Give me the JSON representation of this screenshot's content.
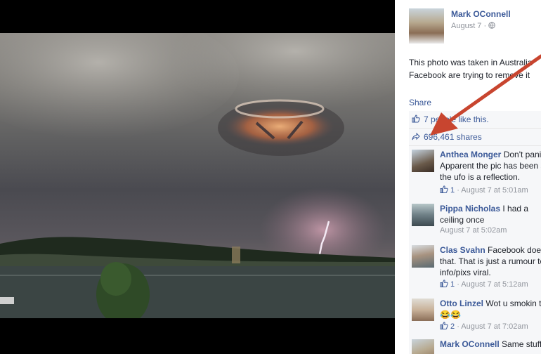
{
  "post": {
    "author": "Mark OConnell",
    "date": "August 7",
    "separator": "·",
    "privacy_icon": "globe-icon",
    "text": "This photo was taken in Australia Facebook are trying to remove it",
    "share_label": "Share",
    "likes": "7 people like this.",
    "shares": "696,461 shares"
  },
  "comments": [
    {
      "name": "Anthea Monger",
      "text": "Don't panic Apparent the pic has been so the ufo is a reflection.",
      "likes": "1",
      "time": "· August 7 at 5:01am"
    },
    {
      "name": "Pippa Nicholas",
      "text": "I had a ceiling once",
      "likes": "",
      "time": "August 7 at 5:02am"
    },
    {
      "name": "Clas Svahn",
      "text": "Facebook does that. That is just a rumour to info/pixs viral.",
      "likes": "1",
      "time": "· August 7 at 5:12am"
    },
    {
      "name": "Otto Linzel",
      "text": "Wot u smokin th 😂😂",
      "likes": "2",
      "time": "· August 7 at 7:02am"
    },
    {
      "name": "Mark OConnell",
      "text": "Same stuff",
      "likes": "",
      "time": ""
    }
  ],
  "colors": {
    "link": "#3b5998",
    "meta": "#90949c",
    "annotation_arrow": "#c8452f",
    "ufi_bg": "#f6f7f9"
  }
}
